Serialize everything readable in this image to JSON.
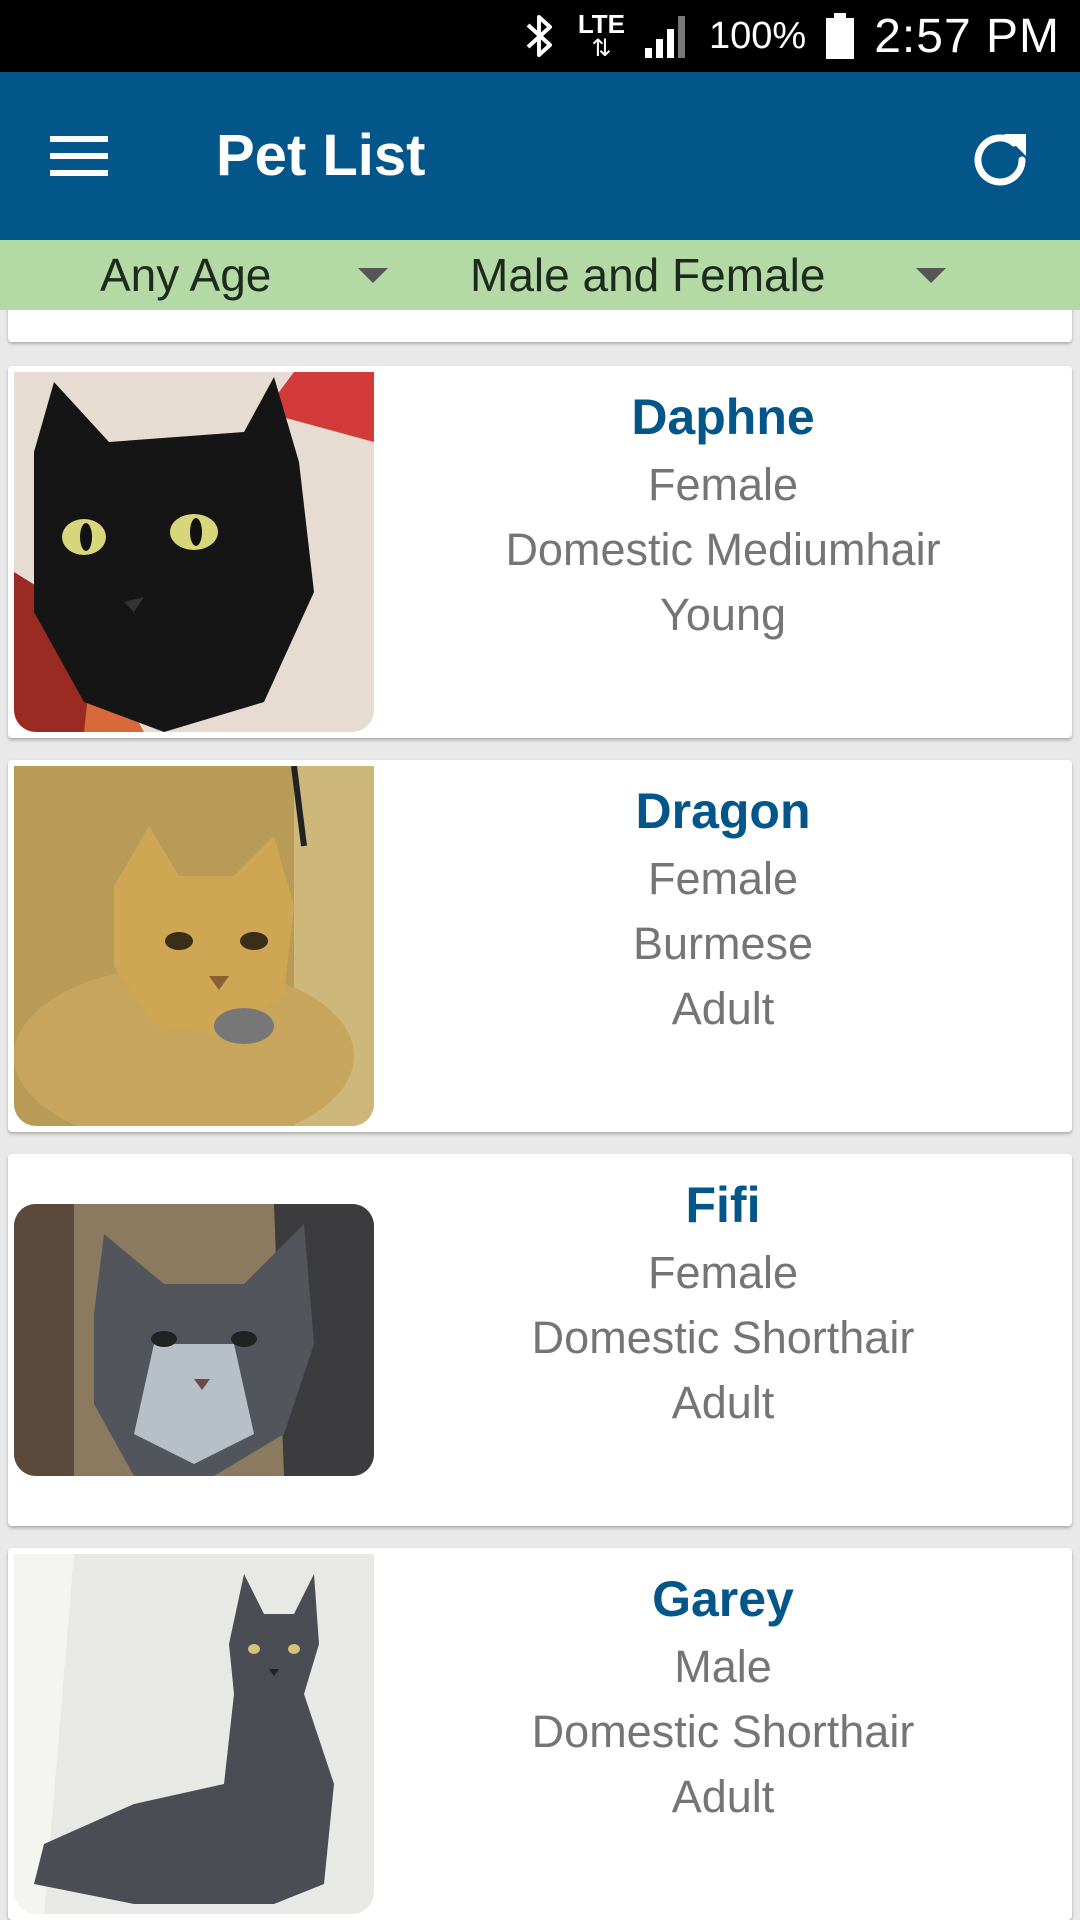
{
  "status_bar": {
    "network": "LTE",
    "battery": "100%",
    "time": "2:57 PM",
    "icons": [
      "bluetooth-icon",
      "lte-icon",
      "signal-icon",
      "battery-icon"
    ]
  },
  "app_bar": {
    "title": "Pet List",
    "menu_icon": "hamburger-menu-icon",
    "refresh_icon": "refresh-icon",
    "color": "#03568a"
  },
  "filters": {
    "age": "Any Age",
    "sex": "Male and Female",
    "color": "#b3d9a5"
  },
  "pets": [
    {
      "name": "Daphne",
      "sex": "Female",
      "breed": "Domestic Mediumhair",
      "age": "Young"
    },
    {
      "name": "Dragon",
      "sex": "Female",
      "breed": "Burmese",
      "age": "Adult"
    },
    {
      "name": "Fifi",
      "sex": "Female",
      "breed": "Domestic Shorthair",
      "age": "Adult"
    },
    {
      "name": "Garey",
      "sex": "Male",
      "breed": "Domestic Shorthair",
      "age": "Adult"
    }
  ]
}
